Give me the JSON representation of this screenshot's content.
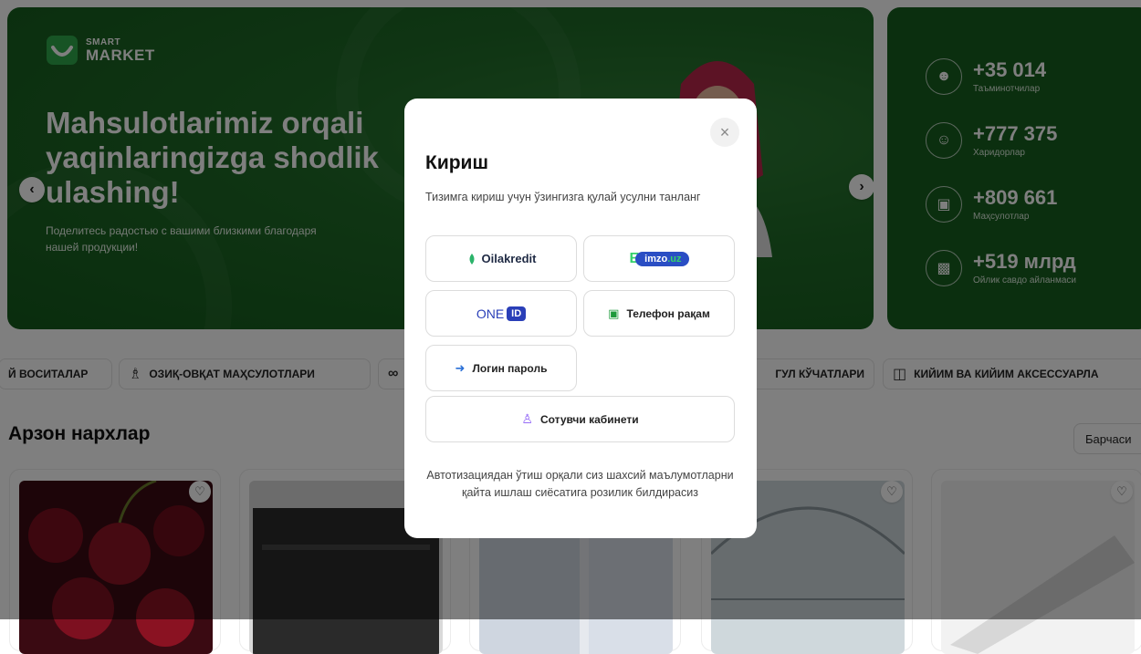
{
  "hero": {
    "logo_small": "SMART",
    "logo_big": "MARKET",
    "title": "Mahsulotlarimiz orqali\nyaqinlaringizga shodlik\nulashing!",
    "subtitle": "Поделитесь радостью с вашими близкими благодаря нашей продукции!",
    "prev_icon": "‹",
    "next_icon": "›"
  },
  "stats": [
    {
      "icon": "user-icon",
      "value": "+35 014",
      "label": "Таъминотчилар"
    },
    {
      "icon": "group-icon",
      "value": "+777 375",
      "label": "Харидорлар"
    },
    {
      "icon": "box-icon",
      "value": "+809 661",
      "label": "Маҳсулотлар"
    },
    {
      "icon": "money-icon",
      "value": "+519 млрд",
      "label": "Ойлик савдо айланмаси"
    }
  ],
  "categories": [
    {
      "label": "Й ВОСИТАЛАР"
    },
    {
      "label": "ОЗИҚ-ОВҚАТ МАҲСУЛОТЛАРИ"
    },
    {
      "label": ""
    },
    {
      "label": "ГУЛ КЎЧАТЛАРИ"
    },
    {
      "label": "КИЙИМ ВА КИЙИМ АКСЕССУАРЛА"
    }
  ],
  "section": {
    "title": "Арзон нархлар",
    "all_label": "Барчаси"
  },
  "modal": {
    "title": "Кириш",
    "subtitle": "Тизимга кириш учун ўзингизга қулай усулни танланг",
    "close": "×",
    "options": {
      "oilakredit": "Oilakredit",
      "imzo_e": "E",
      "imzo_name": "imzo",
      "imzo_tld": ".uz",
      "oneid_text": "ONE",
      "oneid_box": "ID",
      "phone": "Телефон рақам",
      "login": "Логин пароль",
      "seller": "Сотувчи кабинети"
    },
    "footer": "Автотизациядан ўтиш орқали сиз шахсий маълумотларни қайта ишлаш сиёсатига розилик билдирасиз"
  },
  "colors": {
    "brand_green": "#175f1f",
    "accent_blue": "#2a3fb8",
    "overlay": "rgba(0,0,0,0.5)"
  }
}
